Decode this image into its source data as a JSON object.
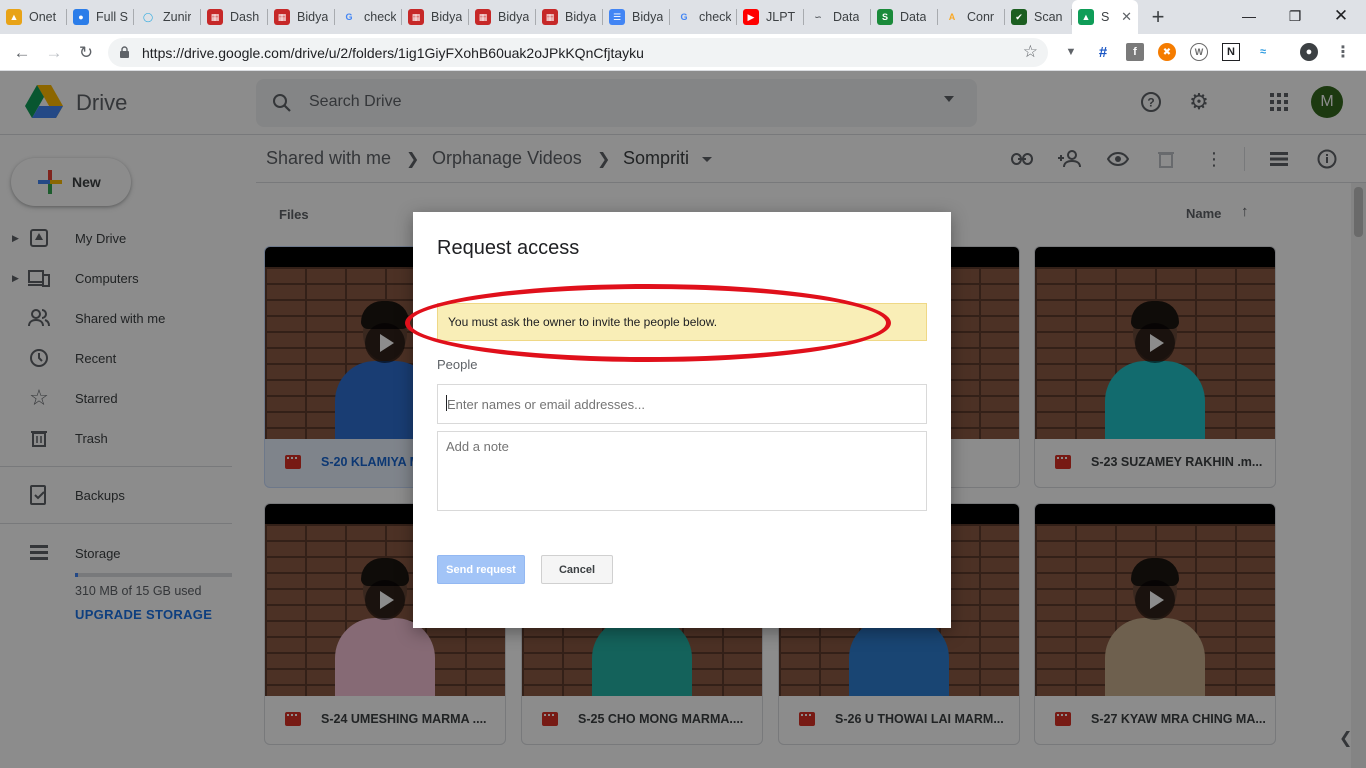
{
  "browser": {
    "tabs": [
      {
        "label": "Onet",
        "icon": "cube-icon",
        "color": "#e8a317"
      },
      {
        "label": "Full S",
        "icon": "globe-icon",
        "color": "#2b7de9"
      },
      {
        "label": "Zunir",
        "icon": "spinner-icon",
        "color": "#22a7e0"
      },
      {
        "label": "Dash",
        "icon": "bidyanondo-icon",
        "color": "#c62828"
      },
      {
        "label": "Bidya",
        "icon": "bidyanondo-icon",
        "color": "#c62828"
      },
      {
        "label": "check",
        "icon": "google-icon",
        "color": "#4285f4"
      },
      {
        "label": "Bidya",
        "icon": "bidyanondo-icon",
        "color": "#c62828"
      },
      {
        "label": "Bidya",
        "icon": "bidyanondo-icon",
        "color": "#c62828"
      },
      {
        "label": "Bidya",
        "icon": "bidyanondo-icon",
        "color": "#c62828"
      },
      {
        "label": "Bidya",
        "icon": "docs-icon",
        "color": "#4285f4"
      },
      {
        "label": "check",
        "icon": "google-icon",
        "color": "#4285f4"
      },
      {
        "label": "JLPT",
        "icon": "youtube-icon",
        "color": "#ff0000"
      },
      {
        "label": "Data",
        "icon": "datastudio-icon",
        "color": "#5f6368"
      },
      {
        "label": "Data",
        "icon": "stm-icon",
        "color": "#1a8a3a"
      },
      {
        "label": "Conr",
        "icon": "a-icon",
        "color": "#f9a825"
      },
      {
        "label": "Scan",
        "icon": "check-circle-icon",
        "color": "#1b5e20"
      },
      {
        "label": "S",
        "icon": "drive-icon",
        "color": "#0f9d58",
        "active": true
      }
    ],
    "url": "https://drive.google.com/drive/u/2/folders/1ig1GiyFXohB60uak2oJPkKQnCfjtayku"
  },
  "header": {
    "app_name": "Drive",
    "search_placeholder": "Search Drive",
    "avatar_letter": "M"
  },
  "sidebar": {
    "new_label": "New",
    "items": [
      {
        "label": "My Drive",
        "icon": "my-drive-icon"
      },
      {
        "label": "Computers",
        "icon": "computers-icon"
      },
      {
        "label": "Shared with me",
        "icon": "shared-icon"
      },
      {
        "label": "Recent",
        "icon": "clock-icon"
      },
      {
        "label": "Starred",
        "icon": "star-icon"
      },
      {
        "label": "Trash",
        "icon": "trash-icon"
      },
      {
        "label": "Backups",
        "icon": "backups-icon"
      }
    ],
    "storage_label": "Storage",
    "storage_used": "310 MB of 15 GB used",
    "storage_fraction": 0.02,
    "upgrade_label": "UPGRADE STORAGE"
  },
  "breadcrumb": [
    "Shared with me",
    "Orphanage Videos",
    "Sompriti"
  ],
  "main": {
    "files_label": "Files",
    "sort_label": "Name",
    "files": [
      {
        "name": "S-20 KLAMIYA M",
        "shirt": "#2f6fd1"
      },
      {
        "name": "",
        "shirt": "#2aa8a8"
      },
      {
        "name": "Y MAR...",
        "shirt": "#b71c1c"
      },
      {
        "name": "S-23 SUZAMEY RAKHIN .m...",
        "shirt": "#22c3c9"
      },
      {
        "name": "S-24 UMESHING MARMA ....",
        "shirt": "#f4c2d6"
      },
      {
        "name": "S-25 CHO MONG MARMA....",
        "shirt": "#26b3a6"
      },
      {
        "name": "S-26 U THOWAI LAI MARM...",
        "shirt": "#2f7fd1"
      },
      {
        "name": "S-27 KYAW MRA CHING MA...",
        "shirt": "#c9b08f"
      }
    ]
  },
  "dialog": {
    "title": "Request access",
    "warning": "You must ask the owner to invite the people below.",
    "people_label": "People",
    "people_placeholder": "Enter names or email addresses...",
    "note_placeholder": "Add a note",
    "send_label": "Send request",
    "cancel_label": "Cancel"
  },
  "colors": {
    "annotation_red": "#e0101b",
    "warning_bg": "#f9eeb7",
    "accent": "#1a73e8"
  }
}
